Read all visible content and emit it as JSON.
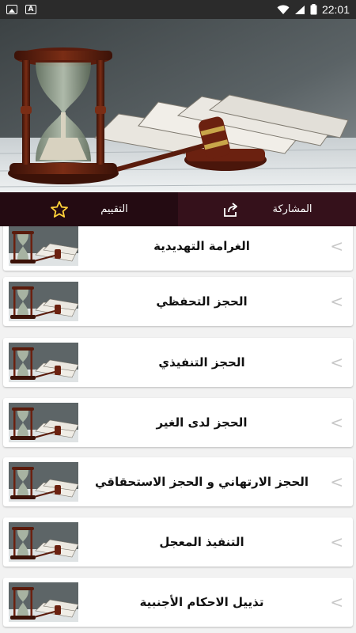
{
  "status_bar": {
    "time": "22:01",
    "icons": [
      "image-notification-icon",
      "a-notification-icon",
      "wifi-icon",
      "signal-icon",
      "battery-icon"
    ]
  },
  "hero": {
    "image": "hourglass-gavel-books-icon"
  },
  "actions": {
    "share_label": "المشاركة",
    "share_icon": "share-icon",
    "rating_label": "التقييم",
    "rating_icon": "star-icon"
  },
  "list": {
    "items": [
      {
        "title": "الغرامة التهديدية"
      },
      {
        "title": "الحجز التحفظي"
      },
      {
        "title": "الحجز التنفيذي"
      },
      {
        "title": "الحجز لدى الغير"
      },
      {
        "title": "الحجز الارتهاني و الحجز الاستحقاقي"
      },
      {
        "title": "التنفيذ المعجل"
      },
      {
        "title": "تذييل الاحكام الأجنبية"
      }
    ],
    "chevron": "<"
  },
  "colors": {
    "actionbar": "#2c0d15",
    "star": "#ffd23a",
    "accent": "#c9a64a"
  }
}
